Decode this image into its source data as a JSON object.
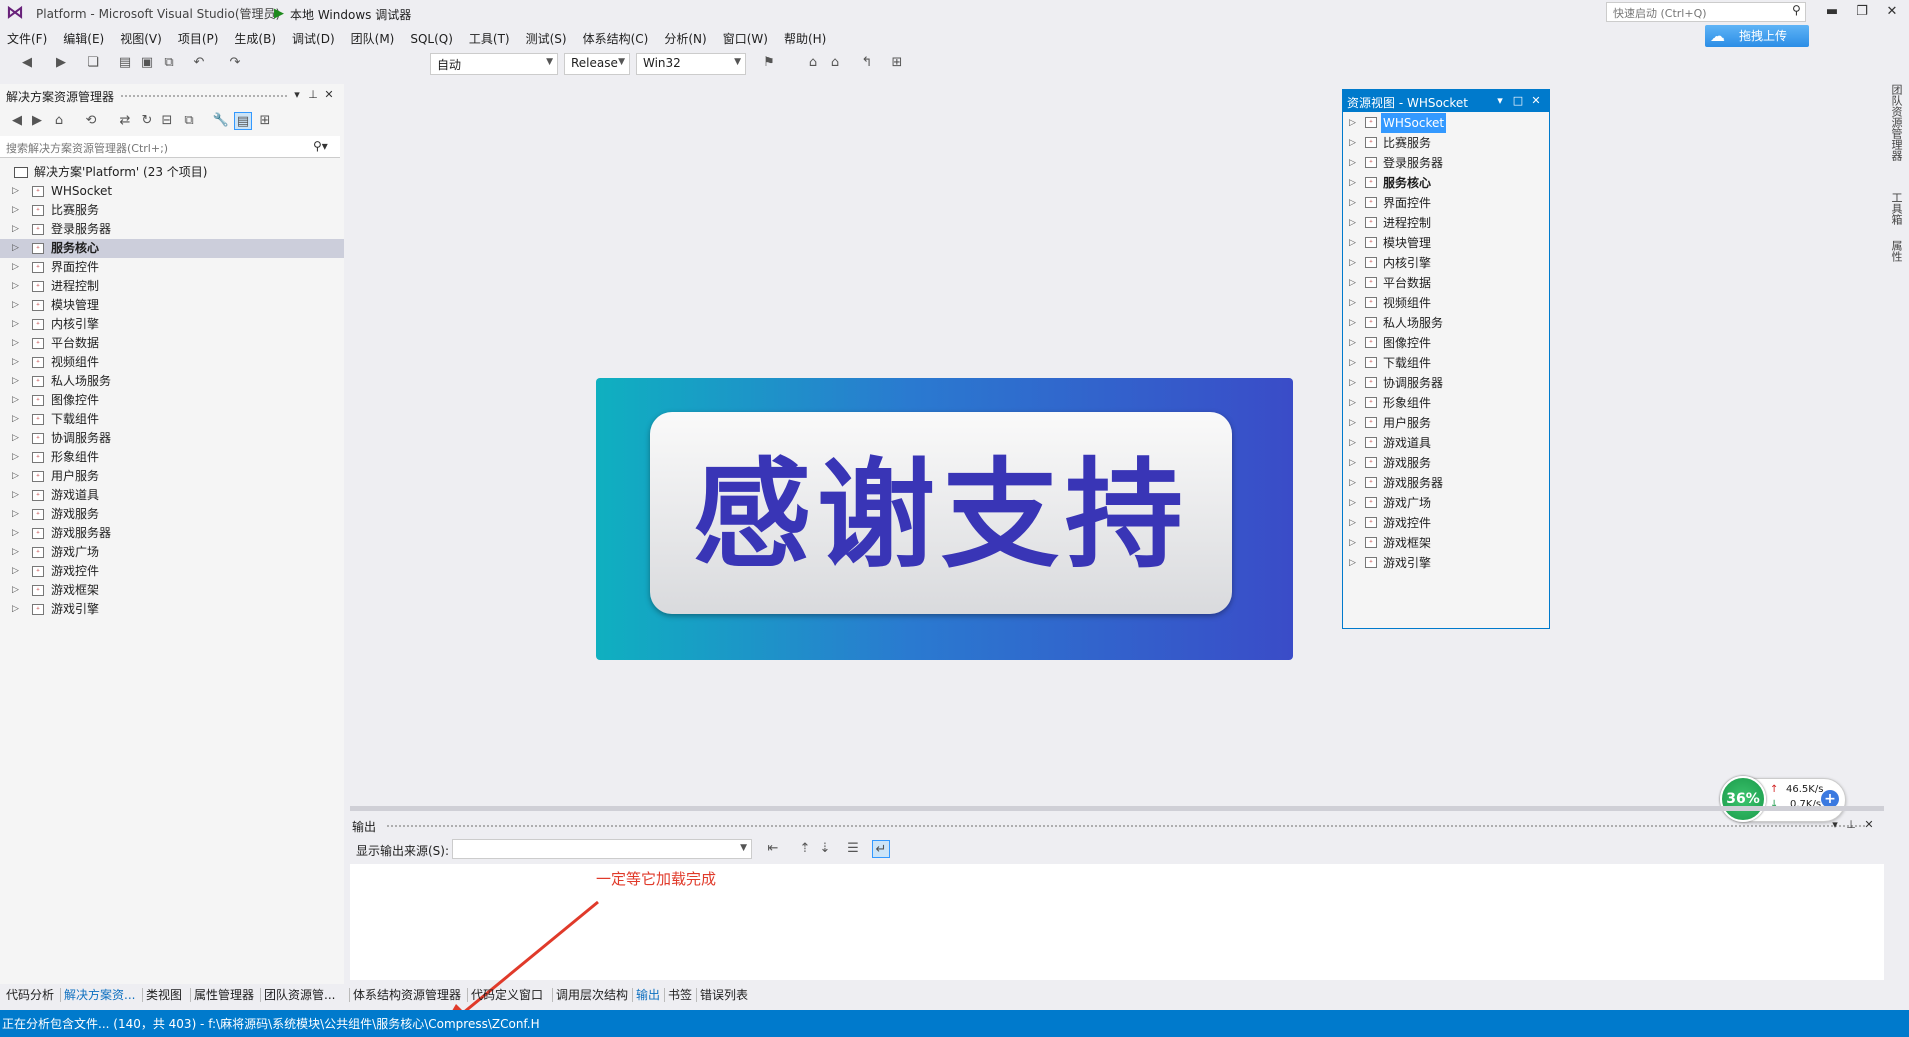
{
  "window": {
    "title": "Platform - Microsoft Visual Studio(管理员)",
    "quick_launch_placeholder": "快速启动 (Ctrl+Q)",
    "upload_button": "拖拽上传"
  },
  "menu": [
    "文件(F)",
    "编辑(E)",
    "视图(V)",
    "项目(P)",
    "生成(B)",
    "调试(D)",
    "团队(M)",
    "SQL(Q)",
    "工具(T)",
    "测试(S)",
    "体系结构(C)",
    "分析(N)",
    "窗口(W)",
    "帮助(H)"
  ],
  "toolbar": {
    "run_label": "本地 Windows 调试器",
    "run_option": "自动",
    "configuration": "Release",
    "platform": "Win32"
  },
  "solution_explorer": {
    "title": "解决方案资源管理器",
    "search_placeholder": "搜索解决方案资源管理器(Ctrl+;)",
    "solution_label": "解决方案'Platform' (23 个项目)",
    "projects": [
      "WHSocket",
      "比赛服务",
      "登录服务器",
      "服务核心",
      "界面控件",
      "进程控制",
      "模块管理",
      "内核引擎",
      "平台数据",
      "视频组件",
      "私人场服务",
      "图像控件",
      "下载组件",
      "协调服务器",
      "形象组件",
      "用户服务",
      "游戏道具",
      "游戏服务",
      "游戏服务器",
      "游戏广场",
      "游戏控件",
      "游戏框架",
      "游戏引擎"
    ],
    "selected_project": "服务核心"
  },
  "banner": {
    "text": "感谢支持"
  },
  "resource_view": {
    "title": "资源视图 - WHSocket",
    "items": [
      "WHSocket",
      "比赛服务",
      "登录服务器",
      "服务核心",
      "界面控件",
      "进程控制",
      "模块管理",
      "内核引擎",
      "平台数据",
      "视频组件",
      "私人场服务",
      "图像控件",
      "下载组件",
      "协调服务器",
      "形象组件",
      "用户服务",
      "游戏道具",
      "游戏服务",
      "游戏服务器",
      "游戏广场",
      "游戏控件",
      "游戏框架",
      "游戏引擎"
    ],
    "selected_item": "WHSocket",
    "bold_item": "服务核心"
  },
  "right_tabs": [
    "团队资源管理器",
    "工具箱",
    "属性"
  ],
  "output": {
    "title": "输出",
    "source_label": "显示输出来源(S):",
    "annotation": "一定等它加载完成"
  },
  "network": {
    "percent": "36%",
    "up": "46.5K/s",
    "down": "0.7K/s"
  },
  "bottom_tabs": [
    "代码分析",
    "解决方案资...",
    "类视图",
    "属性管理器",
    "团队资源管...",
    "体系结构资源管理器",
    "代码定义窗口",
    "调用层次结构",
    "输出",
    "书签",
    "错误列表"
  ],
  "status_bar": {
    "text": "正在分析包含文件... (140，共 403) - f:\\麻将源码\\系统模块\\公共组件\\服务核心\\Compress\\ZConf.H"
  },
  "colors": {
    "accent": "#007acc",
    "annotation": "#e03a2a",
    "banner_text": "#3935b6"
  }
}
